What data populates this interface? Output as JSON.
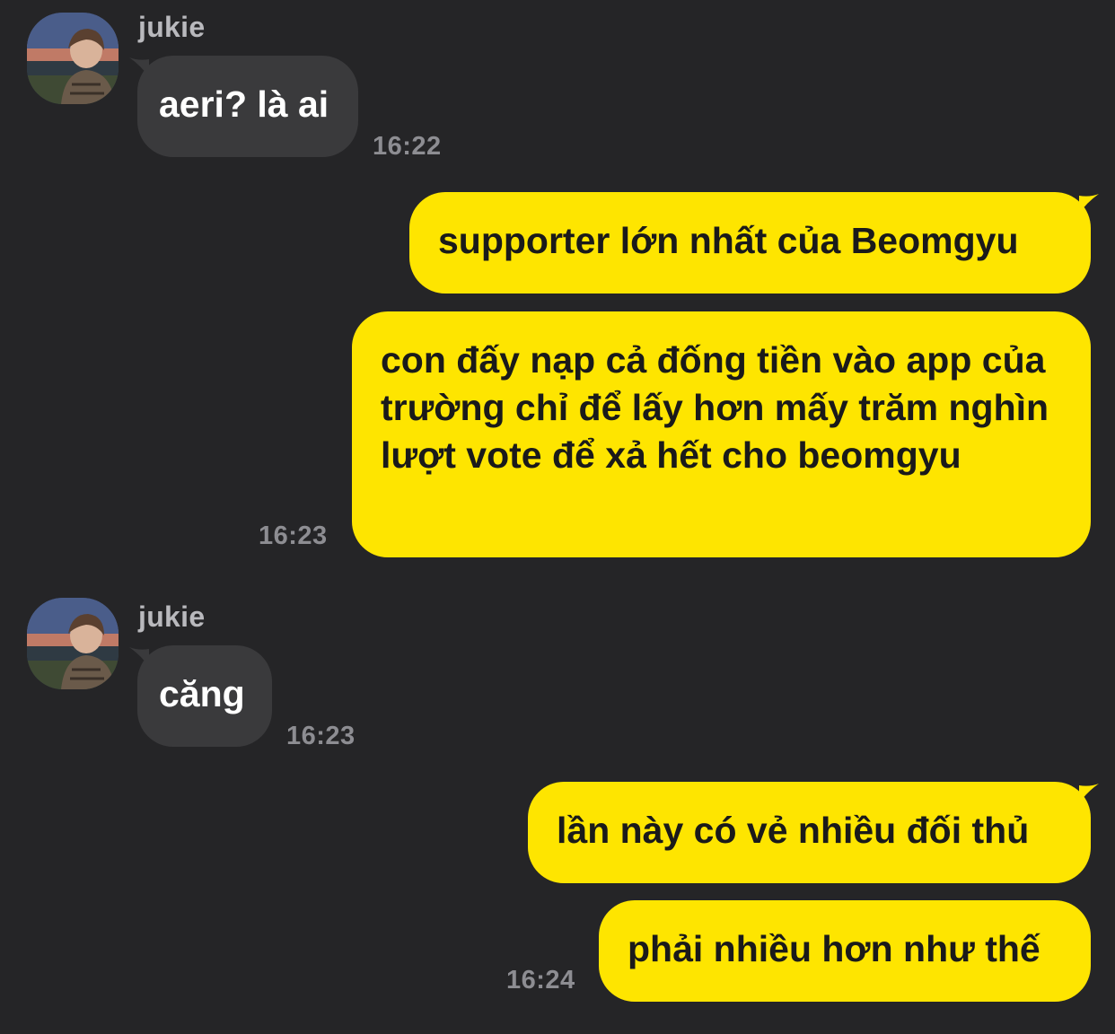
{
  "chat": {
    "messages": [
      {
        "sender": "jukie",
        "direction": "incoming",
        "text": "aeri? là ai",
        "time": "16:22"
      },
      {
        "direction": "outgoing",
        "text": "supporter lớn nhất của Beomgyu"
      },
      {
        "direction": "outgoing",
        "text": "con đấy nạp cả đống tiền vào app của trường chỉ để lấy hơn mấy trăm nghìn lượt vote để xả hết cho beomgyu",
        "time": "16:23"
      },
      {
        "sender": "jukie",
        "direction": "incoming",
        "text": "căng",
        "time": "16:23"
      },
      {
        "direction": "outgoing",
        "text": "lần này có vẻ nhiều đối thủ"
      },
      {
        "direction": "outgoing",
        "text": "phải nhiều hơn như thế",
        "time": "16:24"
      }
    ]
  },
  "colors": {
    "background": "#252527",
    "incoming_bubble": "#3a3a3c",
    "outgoing_bubble": "#fee500",
    "timestamp": "#8d8d92",
    "sender_name": "#b9b9bd"
  }
}
